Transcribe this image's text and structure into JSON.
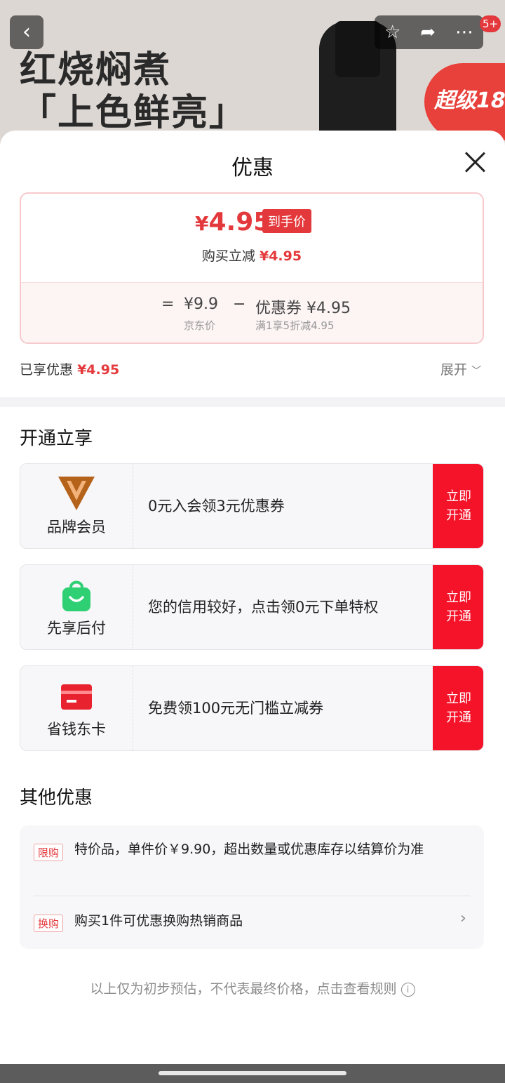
{
  "background": {
    "ad_line1": "红烧焖煮",
    "ad_line2": "「上色鲜亮」",
    "super_badge": "超级18",
    "notification_count": "5+"
  },
  "sheet": {
    "title": "优惠"
  },
  "price_card": {
    "currency": "¥",
    "final_price": "4.95",
    "final_tag": "到手价",
    "reduce_label": "购买立减",
    "reduce_amount": "¥4.95",
    "equals": "=",
    "base_price": "¥9.9",
    "base_label": "京东价",
    "minus": "−",
    "coupon_text": "优惠券 ¥4.95",
    "coupon_rule": "满1享5折减4.95"
  },
  "enjoyed": {
    "label": "已享优惠",
    "amount": "¥4.95",
    "expand_label": "展开"
  },
  "open_section": {
    "title": "开通立享",
    "offers": [
      {
        "name": "品牌会员",
        "desc": "0元入会领3元优惠券",
        "btn_line1": "立即",
        "btn_line2": "开通",
        "icon": "brand-v-icon",
        "color": "#b5621a"
      },
      {
        "name": "先享后付",
        "desc": "您的信用较好，点击领0元下单特权",
        "btn_line1": "立即",
        "btn_line2": "开通",
        "icon": "shopping-bag-icon",
        "color": "#2fcf74"
      },
      {
        "name": "省钱东卡",
        "desc": "免费领100元无门槛立减券",
        "btn_line1": "立即",
        "btn_line2": "开通",
        "icon": "card-icon",
        "color": "#e8232f"
      }
    ]
  },
  "other_section": {
    "title": "其他优惠",
    "items": [
      {
        "tag": "限购",
        "text": "特价品，单件价￥9.90，超出数量或优惠库存以结算价为准"
      },
      {
        "tag": "换购",
        "text": "购买1件可优惠换购热销商品"
      }
    ]
  },
  "footer_note": "以上仅为初步预估，不代表最终价格，点击查看规则",
  "colors": {
    "accent": "#e4393c",
    "button_red": "#f5132a"
  }
}
